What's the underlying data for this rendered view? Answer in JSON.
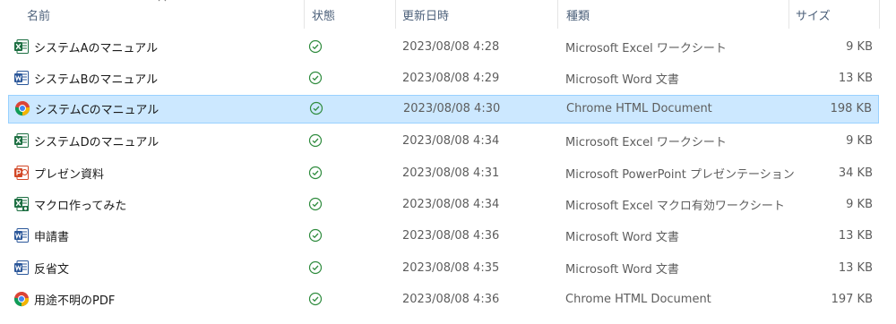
{
  "columns": {
    "name": "名前",
    "status": "状態",
    "date": "更新日時",
    "type": "種類",
    "size": "サイズ"
  },
  "files": [
    {
      "name": "システムAのマニュアル",
      "icon": "excel-icon",
      "date": "2023/08/08 4:28",
      "type": "Microsoft Excel ワークシート",
      "size": "9 KB"
    },
    {
      "name": "システムBのマニュアル",
      "icon": "word-icon",
      "date": "2023/08/08 4:29",
      "type": "Microsoft Word 文書",
      "size": "13 KB"
    },
    {
      "name": "システムCのマニュアル",
      "icon": "chrome-icon",
      "date": "2023/08/08 4:30",
      "type": "Chrome HTML Document",
      "size": "198 KB",
      "selected": true
    },
    {
      "name": "システムDのマニュアル",
      "icon": "excel-icon",
      "date": "2023/08/08 4:34",
      "type": "Microsoft Excel ワークシート",
      "size": "9 KB"
    },
    {
      "name": "プレゼン資料",
      "icon": "powerpoint-icon",
      "date": "2023/08/08 4:31",
      "type": "Microsoft PowerPoint プレゼンテーション",
      "size": "34 KB"
    },
    {
      "name": "マクロ作ってみた",
      "icon": "excel-macro-icon",
      "date": "2023/08/08 4:34",
      "type": "Microsoft Excel マクロ有効ワークシート",
      "size": "9 KB"
    },
    {
      "name": "申請書",
      "icon": "word-icon",
      "date": "2023/08/08 4:36",
      "type": "Microsoft Word 文書",
      "size": "13 KB"
    },
    {
      "name": "反省文",
      "icon": "word-icon",
      "date": "2023/08/08 4:35",
      "type": "Microsoft Word 文書",
      "size": "13 KB"
    },
    {
      "name": "用途不明のPDF",
      "icon": "chrome-icon",
      "date": "2023/08/08 4:36",
      "type": "Chrome HTML Document",
      "size": "197 KB"
    }
  ],
  "status_icon": "synced-check-icon",
  "colors": {
    "selected_bg": "#cce8ff",
    "selected_border": "#99d1ff",
    "excel": "#1d6f42",
    "word": "#2b579a",
    "powerpoint": "#d24726",
    "check": "#2e8b3d"
  }
}
